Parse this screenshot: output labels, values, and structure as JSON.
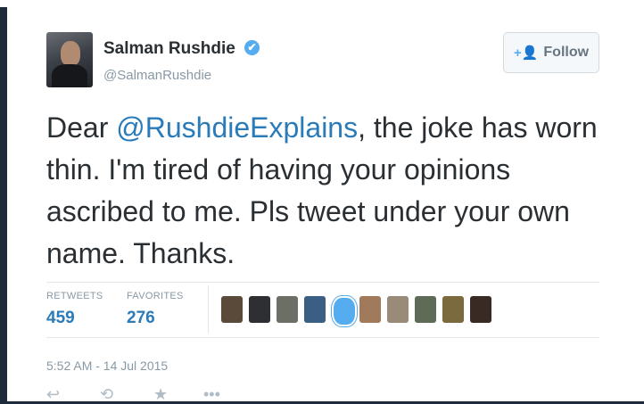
{
  "tweet": {
    "author_name": "Salman Rushdie",
    "author_handle": "@SalmanRushdie",
    "verified_mark": "✔",
    "text_before": "Dear ",
    "mention": "@RushdieExplains",
    "text_after": ", the joke has worn thin. I'm tired of having your opinions ascribed to me. Pls tweet under your own name. Thanks.",
    "timestamp": "5:52 AM - 14 Jul 2015"
  },
  "follow_button": {
    "icon": "+👤",
    "label": "Follow"
  },
  "stats": {
    "retweets_label": "RETWEETS",
    "retweets_value": "459",
    "favorites_label": "FAVORITES",
    "favorites_value": "276"
  },
  "favoriter_avatars": [
    "#5a4a3a",
    "#2e2f33",
    "#6c6f66",
    "#3b5f84",
    "#55acee",
    "#a07a5a",
    "#9a8a78",
    "#5d6b57",
    "#7a6a3e",
    "#3a2a24"
  ],
  "colors": {
    "link": "#2b7bb9",
    "text": "#292f33",
    "muted": "#8899a6",
    "verified": "#55acee"
  },
  "actions": [
    "reply-icon",
    "retweet-icon",
    "favorite-icon",
    "more-icon"
  ]
}
